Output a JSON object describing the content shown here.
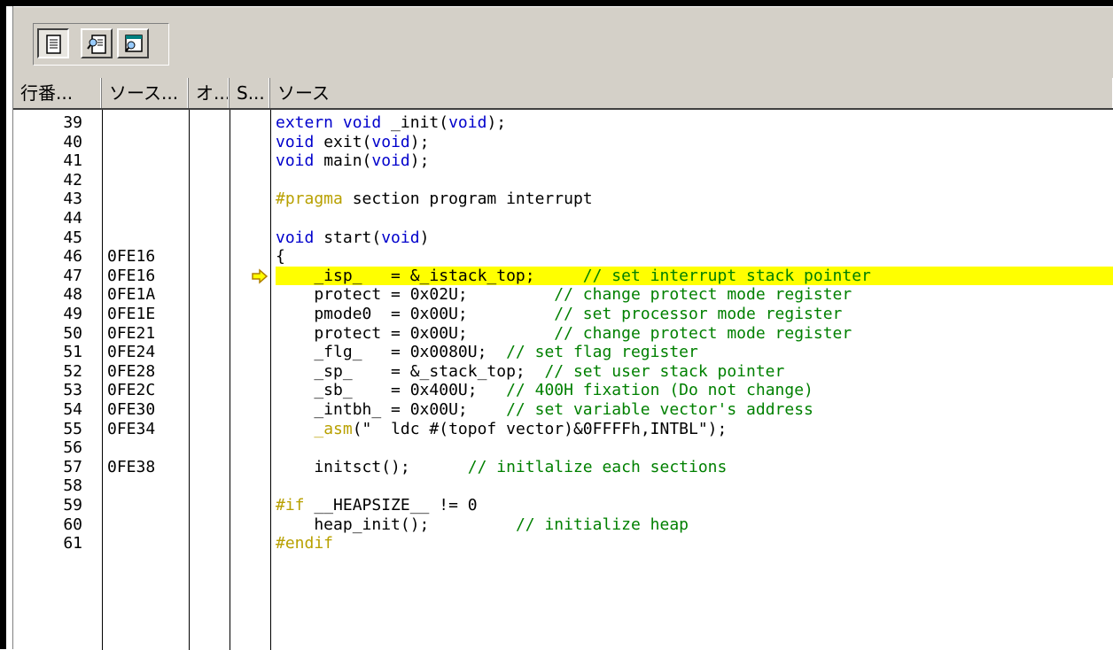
{
  "columns": [
    "行番...",
    "ソース...",
    "オ...",
    "S...",
    "ソース"
  ],
  "rows": [
    {
      "line": "39",
      "addr": "",
      "tokens": [
        {
          "t": "extern void",
          "c": "kw"
        },
        {
          "t": " _init(",
          "c": ""
        },
        {
          "t": "void",
          "c": "kw"
        },
        {
          "t": ");",
          "c": ""
        }
      ]
    },
    {
      "line": "40",
      "addr": "",
      "tokens": [
        {
          "t": "void",
          "c": "kw"
        },
        {
          "t": " exit(",
          "c": ""
        },
        {
          "t": "void",
          "c": "kw"
        },
        {
          "t": ");",
          "c": ""
        }
      ]
    },
    {
      "line": "41",
      "addr": "",
      "tokens": [
        {
          "t": "void",
          "c": "kw"
        },
        {
          "t": " main(",
          "c": ""
        },
        {
          "t": "void",
          "c": "kw"
        },
        {
          "t": ");",
          "c": ""
        }
      ]
    },
    {
      "line": "42",
      "addr": "",
      "tokens": []
    },
    {
      "line": "43",
      "addr": "",
      "tokens": [
        {
          "t": "#pragma",
          "c": "pp"
        },
        {
          "t": " section program interrupt",
          "c": ""
        }
      ]
    },
    {
      "line": "44",
      "addr": "",
      "tokens": []
    },
    {
      "line": "45",
      "addr": "",
      "tokens": [
        {
          "t": "void",
          "c": "kw"
        },
        {
          "t": " start(",
          "c": ""
        },
        {
          "t": "void",
          "c": "kw"
        },
        {
          "t": ")",
          "c": ""
        }
      ]
    },
    {
      "line": "46",
      "addr": "0FE16",
      "tokens": [
        {
          "t": "{",
          "c": ""
        }
      ]
    },
    {
      "line": "47",
      "addr": "0FE16",
      "current": true,
      "tokens": [
        {
          "t": "    _isp_   = &_istack_top;     ",
          "c": ""
        },
        {
          "t": "// set interrupt stack pointer",
          "c": "cm"
        }
      ]
    },
    {
      "line": "48",
      "addr": "0FE1A",
      "tokens": [
        {
          "t": "    protect = 0x02U;         ",
          "c": ""
        },
        {
          "t": "// change protect mode register",
          "c": "cm"
        }
      ]
    },
    {
      "line": "49",
      "addr": "0FE1E",
      "tokens": [
        {
          "t": "    pmode0  = 0x00U;         ",
          "c": ""
        },
        {
          "t": "// set processor mode register",
          "c": "cm"
        }
      ]
    },
    {
      "line": "50",
      "addr": "0FE21",
      "tokens": [
        {
          "t": "    protect = 0x00U;         ",
          "c": ""
        },
        {
          "t": "// change protect mode register",
          "c": "cm"
        }
      ]
    },
    {
      "line": "51",
      "addr": "0FE24",
      "tokens": [
        {
          "t": "    _flg_   = 0x0080U;  ",
          "c": ""
        },
        {
          "t": "// set flag register",
          "c": "cm"
        }
      ]
    },
    {
      "line": "52",
      "addr": "0FE28",
      "tokens": [
        {
          "t": "    _sp_    = &_stack_top;  ",
          "c": ""
        },
        {
          "t": "// set user stack pointer",
          "c": "cm"
        }
      ]
    },
    {
      "line": "53",
      "addr": "0FE2C",
      "tokens": [
        {
          "t": "    _sb_    = 0x400U;   ",
          "c": ""
        },
        {
          "t": "// 400H fixation (Do not change)",
          "c": "cm"
        }
      ]
    },
    {
      "line": "54",
      "addr": "0FE30",
      "tokens": [
        {
          "t": "    _intbh_ = 0x00U;    ",
          "c": ""
        },
        {
          "t": "// set variable vector's address",
          "c": "cm"
        }
      ]
    },
    {
      "line": "55",
      "addr": "0FE34",
      "tokens": [
        {
          "t": "    ",
          "c": ""
        },
        {
          "t": "_asm",
          "c": "asm"
        },
        {
          "t": "(\"  ldc #(topof vector)&0FFFFh,INTBL\");",
          "c": ""
        }
      ]
    },
    {
      "line": "56",
      "addr": "",
      "tokens": []
    },
    {
      "line": "57",
      "addr": "0FE38",
      "tokens": [
        {
          "t": "    initsct();      ",
          "c": ""
        },
        {
          "t": "// initlalize each sections",
          "c": "cm"
        }
      ]
    },
    {
      "line": "58",
      "addr": "",
      "tokens": []
    },
    {
      "line": "59",
      "addr": "",
      "tokens": [
        {
          "t": "#if",
          "c": "pp"
        },
        {
          "t": " __HEAPSIZE__ != 0",
          "c": ""
        }
      ]
    },
    {
      "line": "60",
      "addr": "",
      "tokens": [
        {
          "t": "    heap_init();         ",
          "c": ""
        },
        {
          "t": "// initialize heap",
          "c": "cm"
        }
      ]
    },
    {
      "line": "61",
      "addr": "",
      "tokens": [
        {
          "t": "#endif",
          "c": "pp"
        }
      ]
    }
  ],
  "icons": [
    "source-view-icon",
    "mixed-view-icon",
    "disassembly-view-icon"
  ],
  "colors": {
    "highlight": "#ffff00",
    "keyword": "#0000cc",
    "comment": "#008000",
    "preprocessor": "#b8a000"
  }
}
